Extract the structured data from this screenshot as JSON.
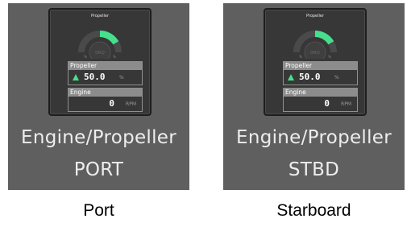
{
  "tiles": [
    {
      "id": "port",
      "gauge_title": "Propeller",
      "gauge_center_label": "0RQ",
      "gauge_min_label": "%",
      "gauge_max_label": "%",
      "gauge_level_percent": 50.0,
      "propeller_label": "Propeller",
      "propeller_value": "50.0",
      "propeller_unit": "%",
      "propeller_trend": "up-arrow-icon",
      "engine_label": "Engine",
      "engine_value": "0",
      "engine_unit": "RPM",
      "caption_line1": "Engine/Propeller",
      "caption_line2": "PORT"
    },
    {
      "id": "stbd",
      "gauge_title": "Propeller",
      "gauge_center_label": "0RQ",
      "gauge_min_label": "%",
      "gauge_max_label": "%",
      "gauge_level_percent": 50.0,
      "propeller_label": "Propeller",
      "propeller_value": "50.0",
      "propeller_unit": "%",
      "propeller_trend": "up-arrow-icon",
      "engine_label": "Engine",
      "engine_value": "0",
      "engine_unit": "RPM",
      "caption_line1": "Engine/Propeller",
      "caption_line2": "STBD"
    }
  ],
  "labels": {
    "port": "Port",
    "stbd": "Starboard"
  },
  "colors": {
    "tile_bg": "#5f5f5f",
    "inner_bg": "#373737",
    "gauge_fill": "#46e08c",
    "trend_arrow": "#46e08c",
    "caption_text": "#ededed"
  }
}
